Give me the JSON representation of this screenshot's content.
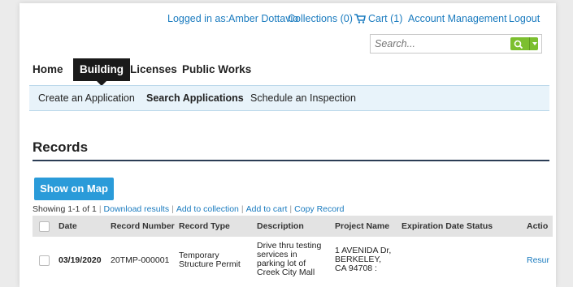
{
  "topbar": {
    "logged_in": "Logged in as:Amber Dottavio",
    "collections": "Collections (0)",
    "cart": "Cart (1)",
    "account": "Account Management",
    "logout": "Logout"
  },
  "search": {
    "placeholder": "Search..."
  },
  "main_nav": {
    "items": [
      "Home",
      "Building",
      "Licenses",
      "Public Works"
    ],
    "active": "Building"
  },
  "sub_nav": {
    "items": [
      "Create an Application",
      "Search Applications",
      "Schedule an Inspection"
    ],
    "active": "Search Applications"
  },
  "records": {
    "title": "Records",
    "show_on_map": "Show on Map",
    "showing": "Showing 1-1 of 1",
    "links": [
      "Download results",
      "Add to collection",
      "Add to cart",
      "Copy Record"
    ],
    "separator": "|"
  },
  "table": {
    "headers": [
      "Date",
      "Record Number",
      "Record Type",
      "Description",
      "Project Name",
      "Expiration Date",
      "Status",
      "Actio"
    ],
    "rows": [
      {
        "date": "03/19/2020",
        "record_number": "20TMP-000001",
        "record_type": "Temporary Structure Permit",
        "description": "Drive thru testing services in parking lot of Creek City Mall",
        "project_name": "1 AVENIDA Dr, BERKELEY, CA 94708 :",
        "expiration_date": "",
        "status": "",
        "action": "Resur"
      }
    ]
  },
  "colors": {
    "link": "#1a7bbf",
    "accent_button": "#2a9bd9",
    "search_button": "#7cbf2f",
    "active_nav": "#1a1a1a"
  }
}
